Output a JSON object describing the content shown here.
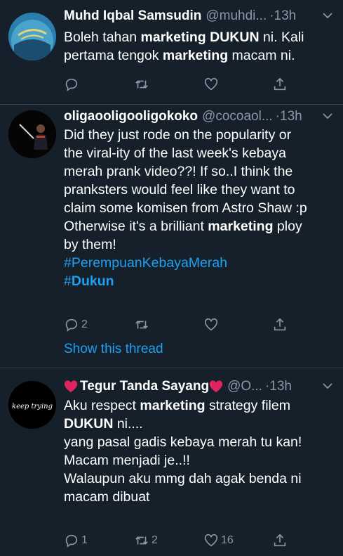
{
  "tweets": [
    {
      "name": "Muhd Iqbal Samsudin",
      "handle": "@muhdi...",
      "time": "·13h",
      "lines": [
        [
          {
            "t": "Boleh tahan ",
            "s": ""
          },
          {
            "t": "marketing DUKUN",
            "s": "b"
          },
          {
            "t": " ni. Kali",
            "s": ""
          }
        ],
        [
          {
            "t": "pertama tengok ",
            "s": ""
          },
          {
            "t": "marketing",
            "s": "b"
          },
          {
            "t": " macam ni.",
            "s": ""
          }
        ]
      ],
      "reply_count": "",
      "retweet_count": "",
      "like_count": ""
    },
    {
      "name": "oligaooligooligokoko",
      "handle": "@cocoaol...",
      "time": "·13h",
      "lines": [
        [
          {
            "t": "Did they just rode on the popularity or",
            "s": ""
          }
        ],
        [
          {
            "t": "the viral-ity of the last week's kebaya",
            "s": ""
          }
        ],
        [
          {
            "t": "merah prank video??! If so..I think the",
            "s": ""
          }
        ],
        [
          {
            "t": "pranksters would feel like they want to",
            "s": ""
          }
        ],
        [
          {
            "t": "claim some komisen from Astro Shaw :p",
            "s": ""
          }
        ],
        [
          {
            "t": " ",
            "s": ""
          }
        ],
        [
          {
            "t": "Otherwise it's a brilliant ",
            "s": ""
          },
          {
            "t": "marketing",
            "s": "b"
          },
          {
            "t": " ploy",
            "s": ""
          }
        ],
        [
          {
            "t": "by them!",
            "s": ""
          }
        ],
        [
          {
            "t": "#PerempuanKebayaMerah",
            "s": "tag"
          }
        ],
        [
          {
            "t": "#",
            "s": "tag"
          },
          {
            "t": "Dukun",
            "s": "tag b"
          }
        ]
      ],
      "reply_count": "2",
      "retweet_count": "",
      "like_count": "",
      "show_thread": "Show this thread"
    },
    {
      "name": "Tegur Tanda Sayang",
      "handle": "@O...",
      "time": "·13h",
      "avatar_text": "keep trying",
      "lines": [
        [
          {
            "t": "Aku respect ",
            "s": ""
          },
          {
            "t": "marketing",
            "s": "b"
          },
          {
            "t": " strategy filem",
            "s": ""
          }
        ],
        [
          {
            "t": "DUKUN",
            "s": "b"
          },
          {
            "t": " ni....",
            "s": ""
          }
        ],
        [
          {
            "t": " ",
            "s": ""
          }
        ],
        [
          {
            "t": "yang pasal gadis kebaya merah tu kan!",
            "s": ""
          }
        ],
        [
          {
            "t": "Macam menjadi je..!!",
            "s": ""
          }
        ],
        [
          {
            "t": "Walaupun aku mmg dah agak benda ni",
            "s": ""
          }
        ],
        [
          {
            "t": "macam dibuat",
            "s": ""
          }
        ]
      ],
      "reply_count": "1",
      "retweet_count": "2",
      "like_count": "16"
    }
  ],
  "colors": {
    "background": "#15202b",
    "secondary": "#8899a6",
    "link": "#1da1f2",
    "divider": "#38444d",
    "heart": "#e0245e"
  }
}
